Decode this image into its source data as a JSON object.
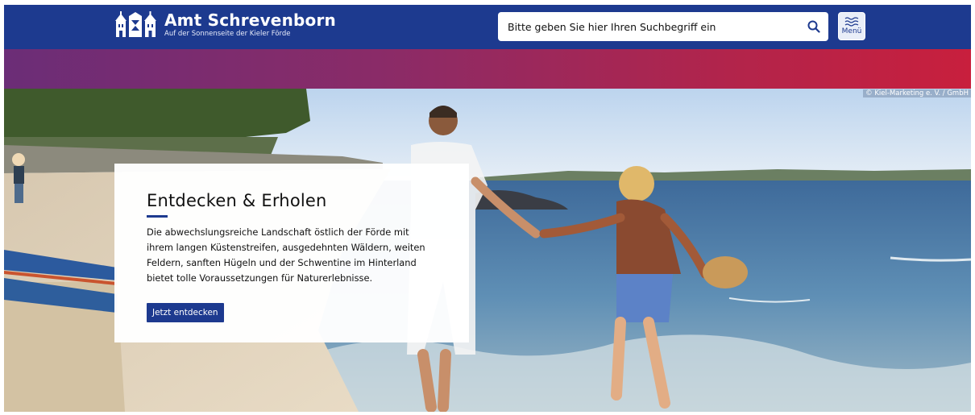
{
  "header": {
    "site_title": "Amt Schrevenborn",
    "site_subtitle": "Auf der Sonnenseite der Kieler Förde",
    "search_placeholder": "Bitte geben Sie hier Ihren Suchbegriff ein",
    "menu_label": "Menü"
  },
  "hero": {
    "photo_credit": "© Kiel-Marketing e. V. / GmbH",
    "title": "Entdecken & Erholen",
    "text": "Die abwechslungsreiche Landschaft östlich der Förde mit ihrem langen Küstenstreifen, ausgedehnten Wäldern, weiten Feldern, sanften Hügeln und der Schwentine im Hinterland bietet tolle Voraussetzungen für Naturerlebnisse.",
    "button_label": "Jetzt entdecken"
  },
  "colors": {
    "brand_blue": "#1d3a8f",
    "gradient_start": "#6b2d77",
    "gradient_end": "#c81f3d"
  },
  "icons": [
    "coat-of-arms-icon",
    "search-icon",
    "waves-menu-icon"
  ]
}
